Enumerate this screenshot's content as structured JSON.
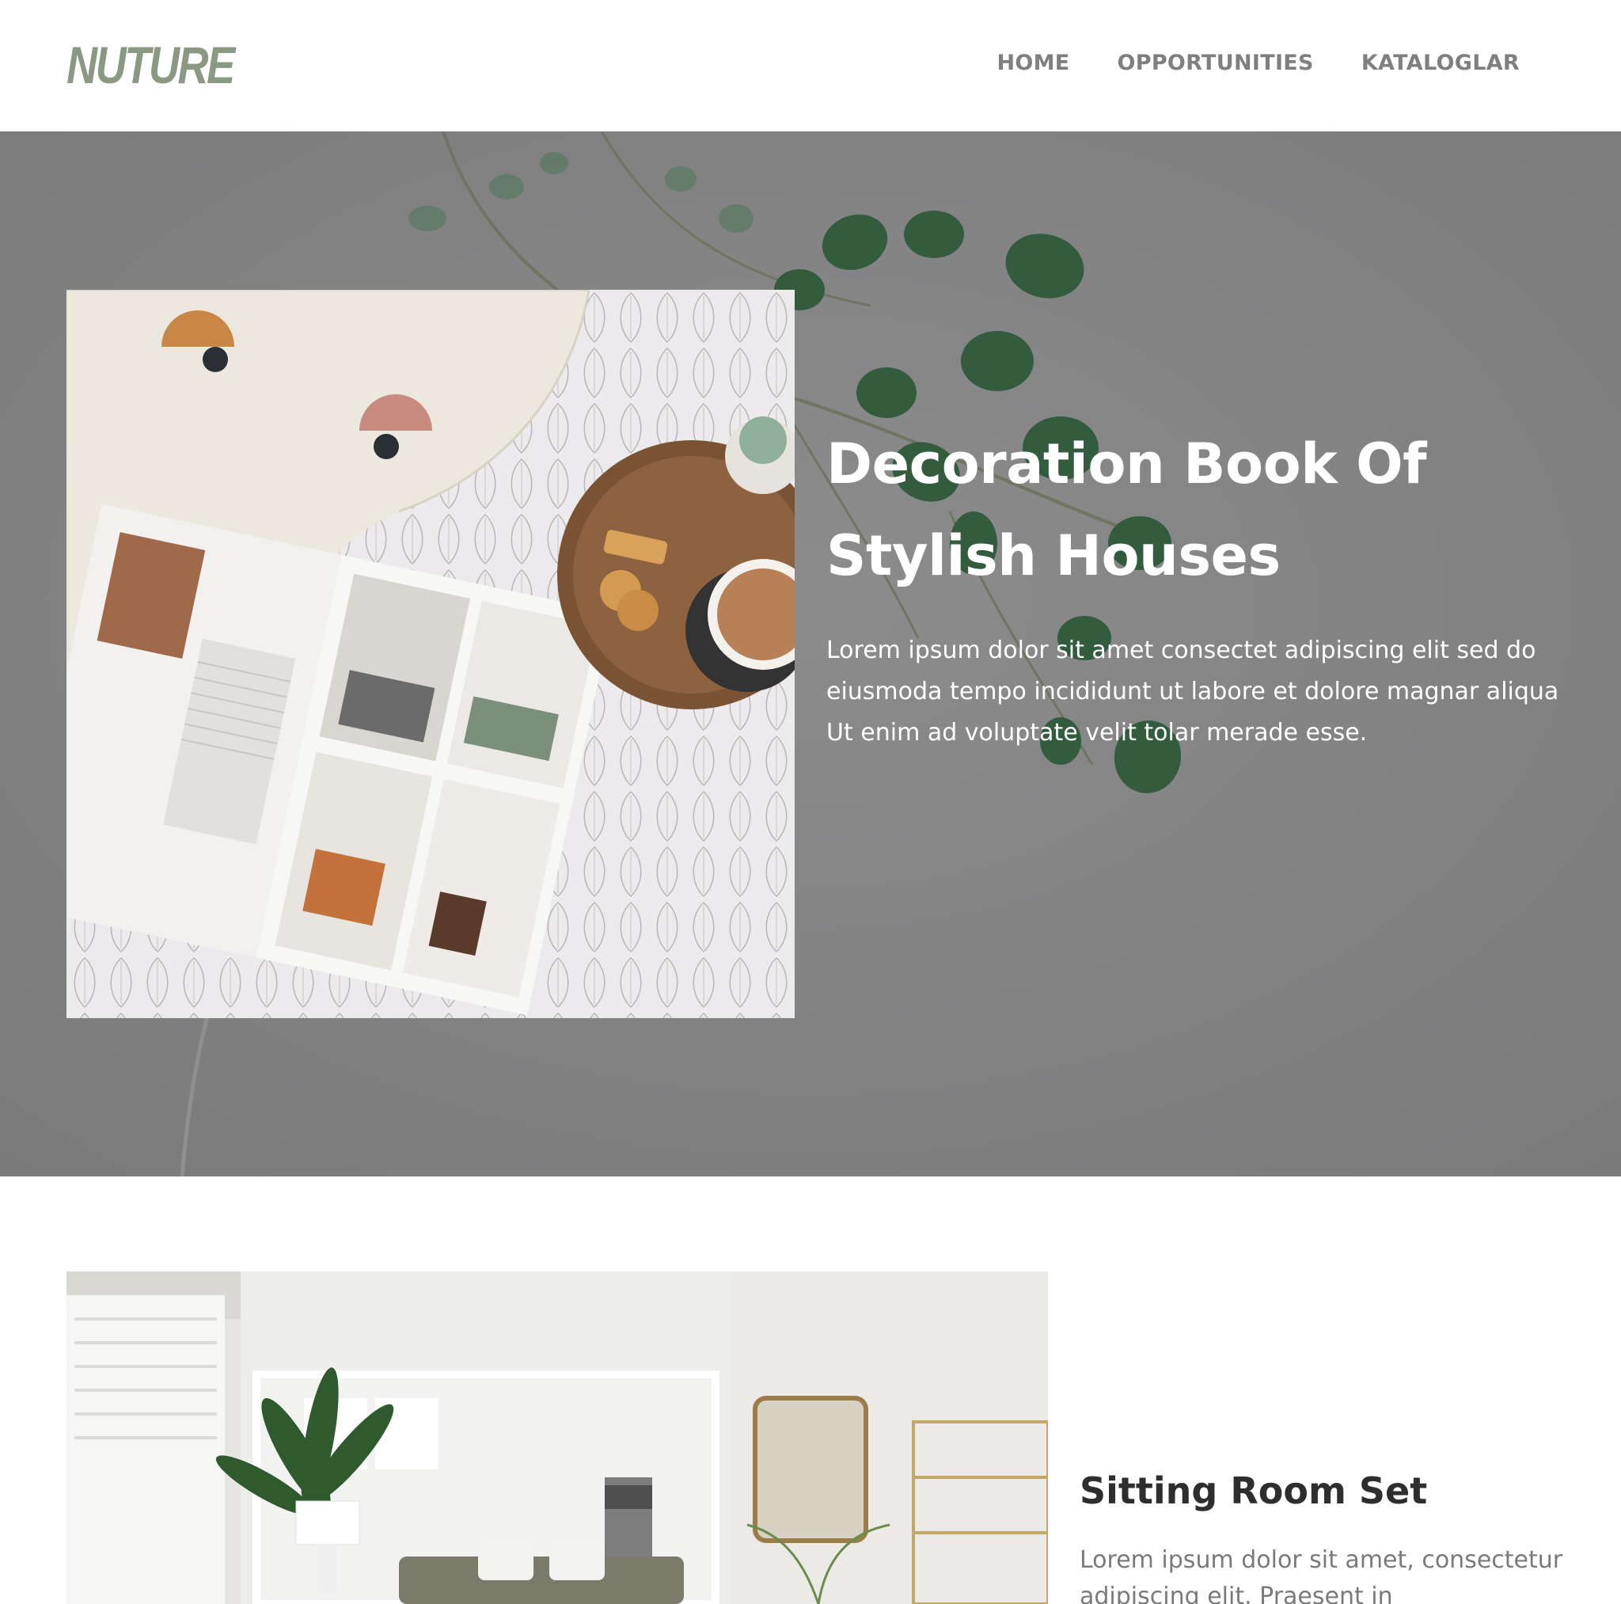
{
  "header": {
    "logo": "NUTURE",
    "nav": [
      {
        "label": "HOME"
      },
      {
        "label": "OPPORTUNITIES"
      },
      {
        "label": "KATALOGLAR"
      }
    ]
  },
  "hero": {
    "title_line1": "Decoration Book Of",
    "title_line2": "Stylish Houses",
    "description": "Lorem ipsum dolor sit amet consectet adipiscing elit sed do eiusmoda tempo incididunt ut labore et dolore magnar aliqua Ut enim ad voluptate velit tolar merade esse."
  },
  "section2": {
    "title": "Sitting Room Set",
    "description": "Lorem ipsum dolor sit amet, consectetur adipiscing elit. Praesent in"
  },
  "colors": {
    "logo": "#8a9a82",
    "nav_text": "#7f7f7f",
    "hero_overlay": "#858586",
    "heading_dark": "#2e2e2e",
    "body_gray": "#7a7a7a"
  }
}
